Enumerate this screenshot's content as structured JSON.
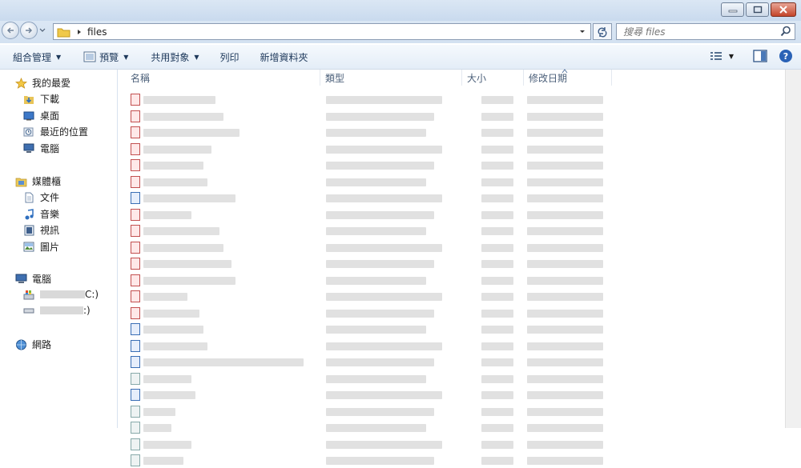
{
  "window": {
    "address_text": "files",
    "search_placeholder": "搜尋 files"
  },
  "toolbar": {
    "organize_label": "組合管理",
    "preview_label": "預覽",
    "share_label": "共用對象",
    "print_label": "列印",
    "new_folder_label": "新增資料夾"
  },
  "sidebar": {
    "favorites": "我的最愛",
    "downloads": "下載",
    "desktop": "桌面",
    "recent": "最近的位置",
    "computer_fav": "電腦",
    "libraries": "媒體櫃",
    "documents": "文件",
    "music": "音樂",
    "videos": "視訊",
    "pictures": "圖片",
    "computer": "電腦",
    "drive_c_suffix": "C:)",
    "drive_2_suffix": ":)",
    "network": "網路"
  },
  "columns": {
    "name": "名稱",
    "type": "類型",
    "size": "大小",
    "modified": "修改日期"
  },
  "colors": {
    "accent": "#1e395b",
    "titlebar": "#c9daee"
  }
}
